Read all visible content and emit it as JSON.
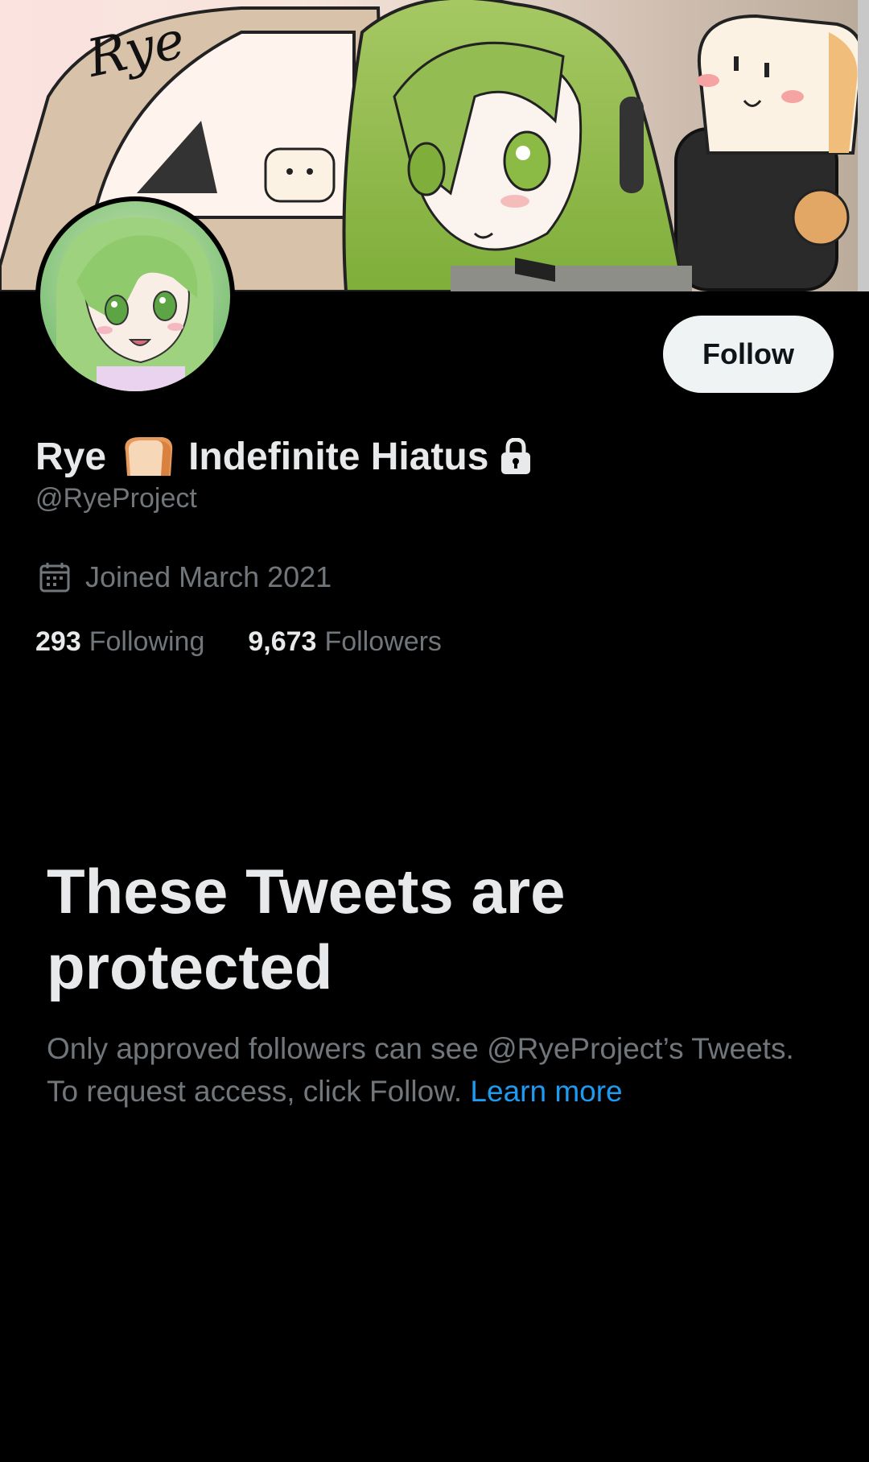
{
  "profile": {
    "name_part1": "Rye",
    "name_part2": "Indefinite Hiatus",
    "handle": "@RyeProject",
    "joined": "Joined March 2021",
    "follow_label": "Follow",
    "banner_signature": "Rye"
  },
  "stats": {
    "following_count": "293",
    "following_label": "Following",
    "followers_count": "9,673",
    "followers_label": "Followers"
  },
  "protected": {
    "title": "These Tweets are protected",
    "body": "Only approved followers can see @RyeProject’s Tweets. To request access, click Follow. ",
    "link": "Learn more"
  },
  "icons": {
    "bread": "bread-emoji-icon",
    "lock": "lock-icon",
    "calendar": "calendar-icon"
  },
  "colors": {
    "background": "#000000",
    "primary_text": "#e7e9ea",
    "secondary_text": "#71767b",
    "link": "#1d9bf0",
    "follow_button_bg": "#eff3f4"
  }
}
